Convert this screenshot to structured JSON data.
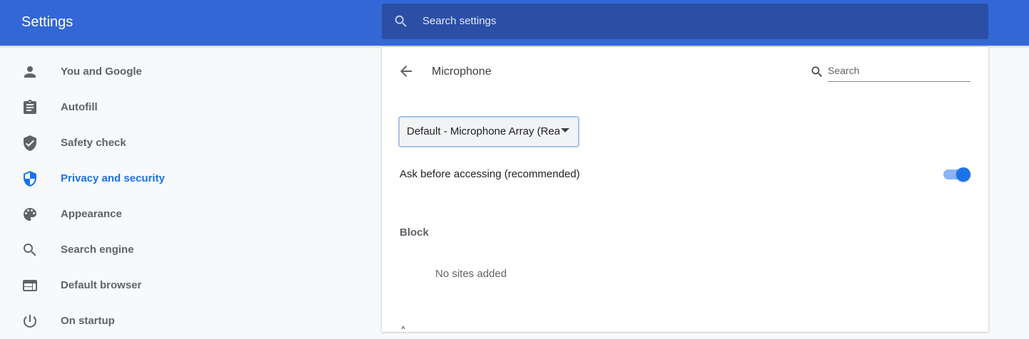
{
  "header": {
    "title": "Settings",
    "search_placeholder": "Search settings",
    "search_icon": "search-icon"
  },
  "sidebar": {
    "items": [
      {
        "label": "You and Google",
        "icon": "person-icon",
        "active": false
      },
      {
        "label": "Autofill",
        "icon": "clipboard-icon",
        "active": false
      },
      {
        "label": "Safety check",
        "icon": "shield-check-icon",
        "active": false
      },
      {
        "label": "Privacy and security",
        "icon": "shield-icon",
        "active": true
      },
      {
        "label": "Appearance",
        "icon": "palette-icon",
        "active": false
      },
      {
        "label": "Search engine",
        "icon": "search-icon",
        "active": false
      },
      {
        "label": "Default browser",
        "icon": "browser-window-icon",
        "active": false
      },
      {
        "label": "On startup",
        "icon": "power-icon",
        "active": false
      }
    ]
  },
  "page": {
    "title": "Microphone",
    "back_icon": "back-arrow-icon",
    "search_placeholder": "Search",
    "device_select": {
      "selected": "Default - Microphone Array (Realtek(R) Audio)"
    },
    "ask_label": "Ask before accessing (recommended)",
    "ask_enabled": true,
    "block_heading": "Block",
    "block_empty": "No sites added"
  },
  "colors": {
    "header_bg": "#3367d6",
    "search_bg": "#2a4fa4",
    "accent": "#1a73e8",
    "toggle_track": "#8ab4f8"
  }
}
